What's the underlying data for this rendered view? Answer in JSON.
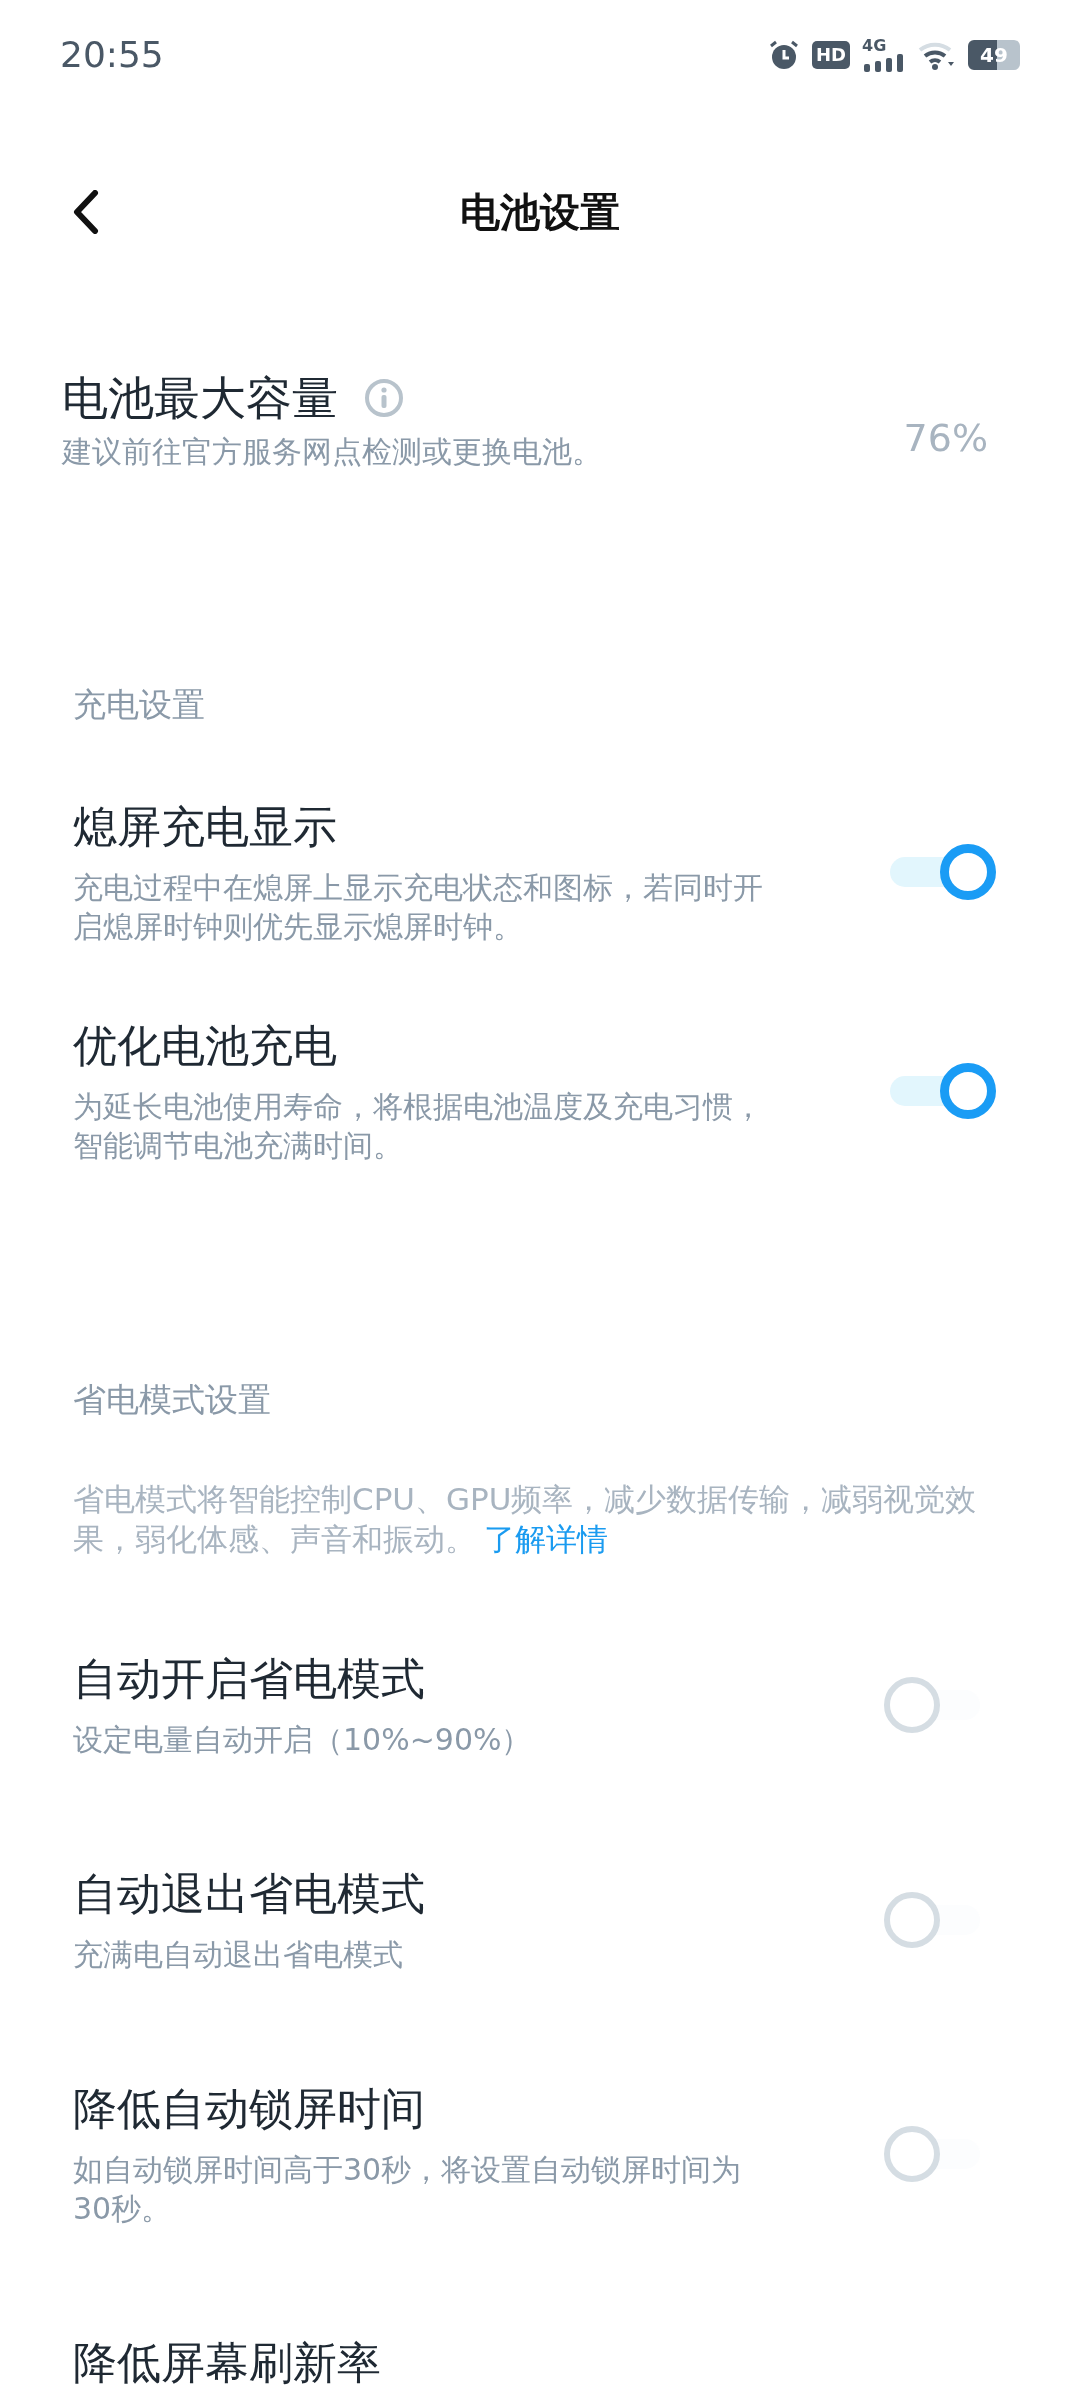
{
  "status_bar": {
    "time": "20:55",
    "hd": "HD",
    "network": "4G",
    "battery": "49"
  },
  "header": {
    "title": "电池设置"
  },
  "capacity": {
    "title": "电池最大容量",
    "subtitle": "建议前往官方服务网点检测或更换电池。",
    "value": "76%"
  },
  "sections": [
    {
      "title": "充电设置",
      "items": [
        {
          "kind": "switch",
          "title": "熄屏充电显示",
          "description": "充电过程中在熄屏上显示充电状态和图标，若同时开启熄屏时钟则优先显示熄屏时钟。",
          "on": true
        },
        {
          "kind": "switch",
          "title": "优化电池充电",
          "description": "为延长电池使用寿命，将根据电池温度及充电习惯，智能调节电池充满时间。",
          "on": true
        }
      ]
    },
    {
      "title": "省电模式设置",
      "intro": "省电模式将智能控制CPU、GPU频率，减少数据传输，减弱视觉效果，弱化体感、声音和振动。",
      "link": "了解详情",
      "items": [
        {
          "kind": "switch",
          "title": "自动开启省电模式",
          "description": "设定电量自动开启（10%~90%）",
          "on": false
        },
        {
          "kind": "switch",
          "title": "自动退出省电模式",
          "description": "充满电自动退出省电模式",
          "on": false
        },
        {
          "kind": "switch",
          "title": "降低自动锁屏时间",
          "description": "如自动锁屏时间高于30秒，将设置自动锁屏时间为30秒。",
          "on": false
        },
        {
          "kind": "title",
          "title": "降低屏幕刷新率"
        }
      ]
    }
  ]
}
